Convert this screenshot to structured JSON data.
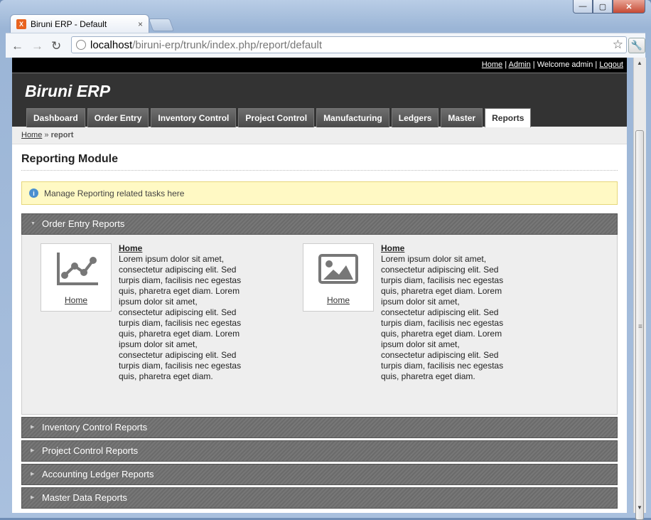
{
  "browser": {
    "tab_title": "Biruni ERP - Default",
    "tab_favicon": "X",
    "url_host": "localhost",
    "url_path": "/biruni-erp/trunk/index.php/report/default",
    "tab_close": "×",
    "win_min": "—",
    "win_max": "▢",
    "win_close": "✕",
    "back": "←",
    "forward": "→",
    "reload": "↻",
    "star": "☆",
    "wrench": "🔧"
  },
  "topbar": {
    "home": "Home",
    "admin": "Admin",
    "welcome": "Welcome admin",
    "logout": "Logout"
  },
  "logo": "Biruni ERP",
  "menu": [
    "Dashboard",
    "Order Entry",
    "Inventory Control",
    "Project Control",
    "Manufacturing",
    "Ledgers",
    "Master",
    "Reports"
  ],
  "breadcrumb": {
    "home": "Home",
    "sep": " » ",
    "current": "report"
  },
  "page_title": "Reporting Module",
  "info": {
    "icon": "i",
    "text": "Manage Reporting related tasks here"
  },
  "sections": {
    "order_entry": "Order Entry Reports",
    "inventory": "Inventory Control Reports",
    "project": "Project Control Reports",
    "ledger": "Accounting Ledger Reports",
    "master": "Master Data Reports"
  },
  "cards": [
    {
      "label": "Home",
      "title": "Home",
      "text": "Lorem ipsum dolor sit amet, consectetur adipiscing elit. Sed turpis diam, facilisis nec egestas quis, pharetra eget diam. Lorem ipsum dolor sit amet, consectetur adipiscing elit. Sed turpis diam, facilisis nec egestas quis, pharetra eget diam. Lorem ipsum dolor sit amet, consectetur adipiscing elit. Sed turpis diam, facilisis nec egestas quis, pharetra eget diam."
    },
    {
      "label": "Home",
      "title": "Home",
      "text": "Lorem ipsum dolor sit amet, consectetur adipiscing elit. Sed turpis diam, facilisis nec egestas quis, pharetra eget diam. Lorem ipsum dolor sit amet, consectetur adipiscing elit. Sed turpis diam, facilisis nec egestas quis, pharetra eget diam. Lorem ipsum dolor sit amet, consectetur adipiscing elit. Sed turpis diam, facilisis nec egestas quis, pharetra eget diam."
    }
  ]
}
